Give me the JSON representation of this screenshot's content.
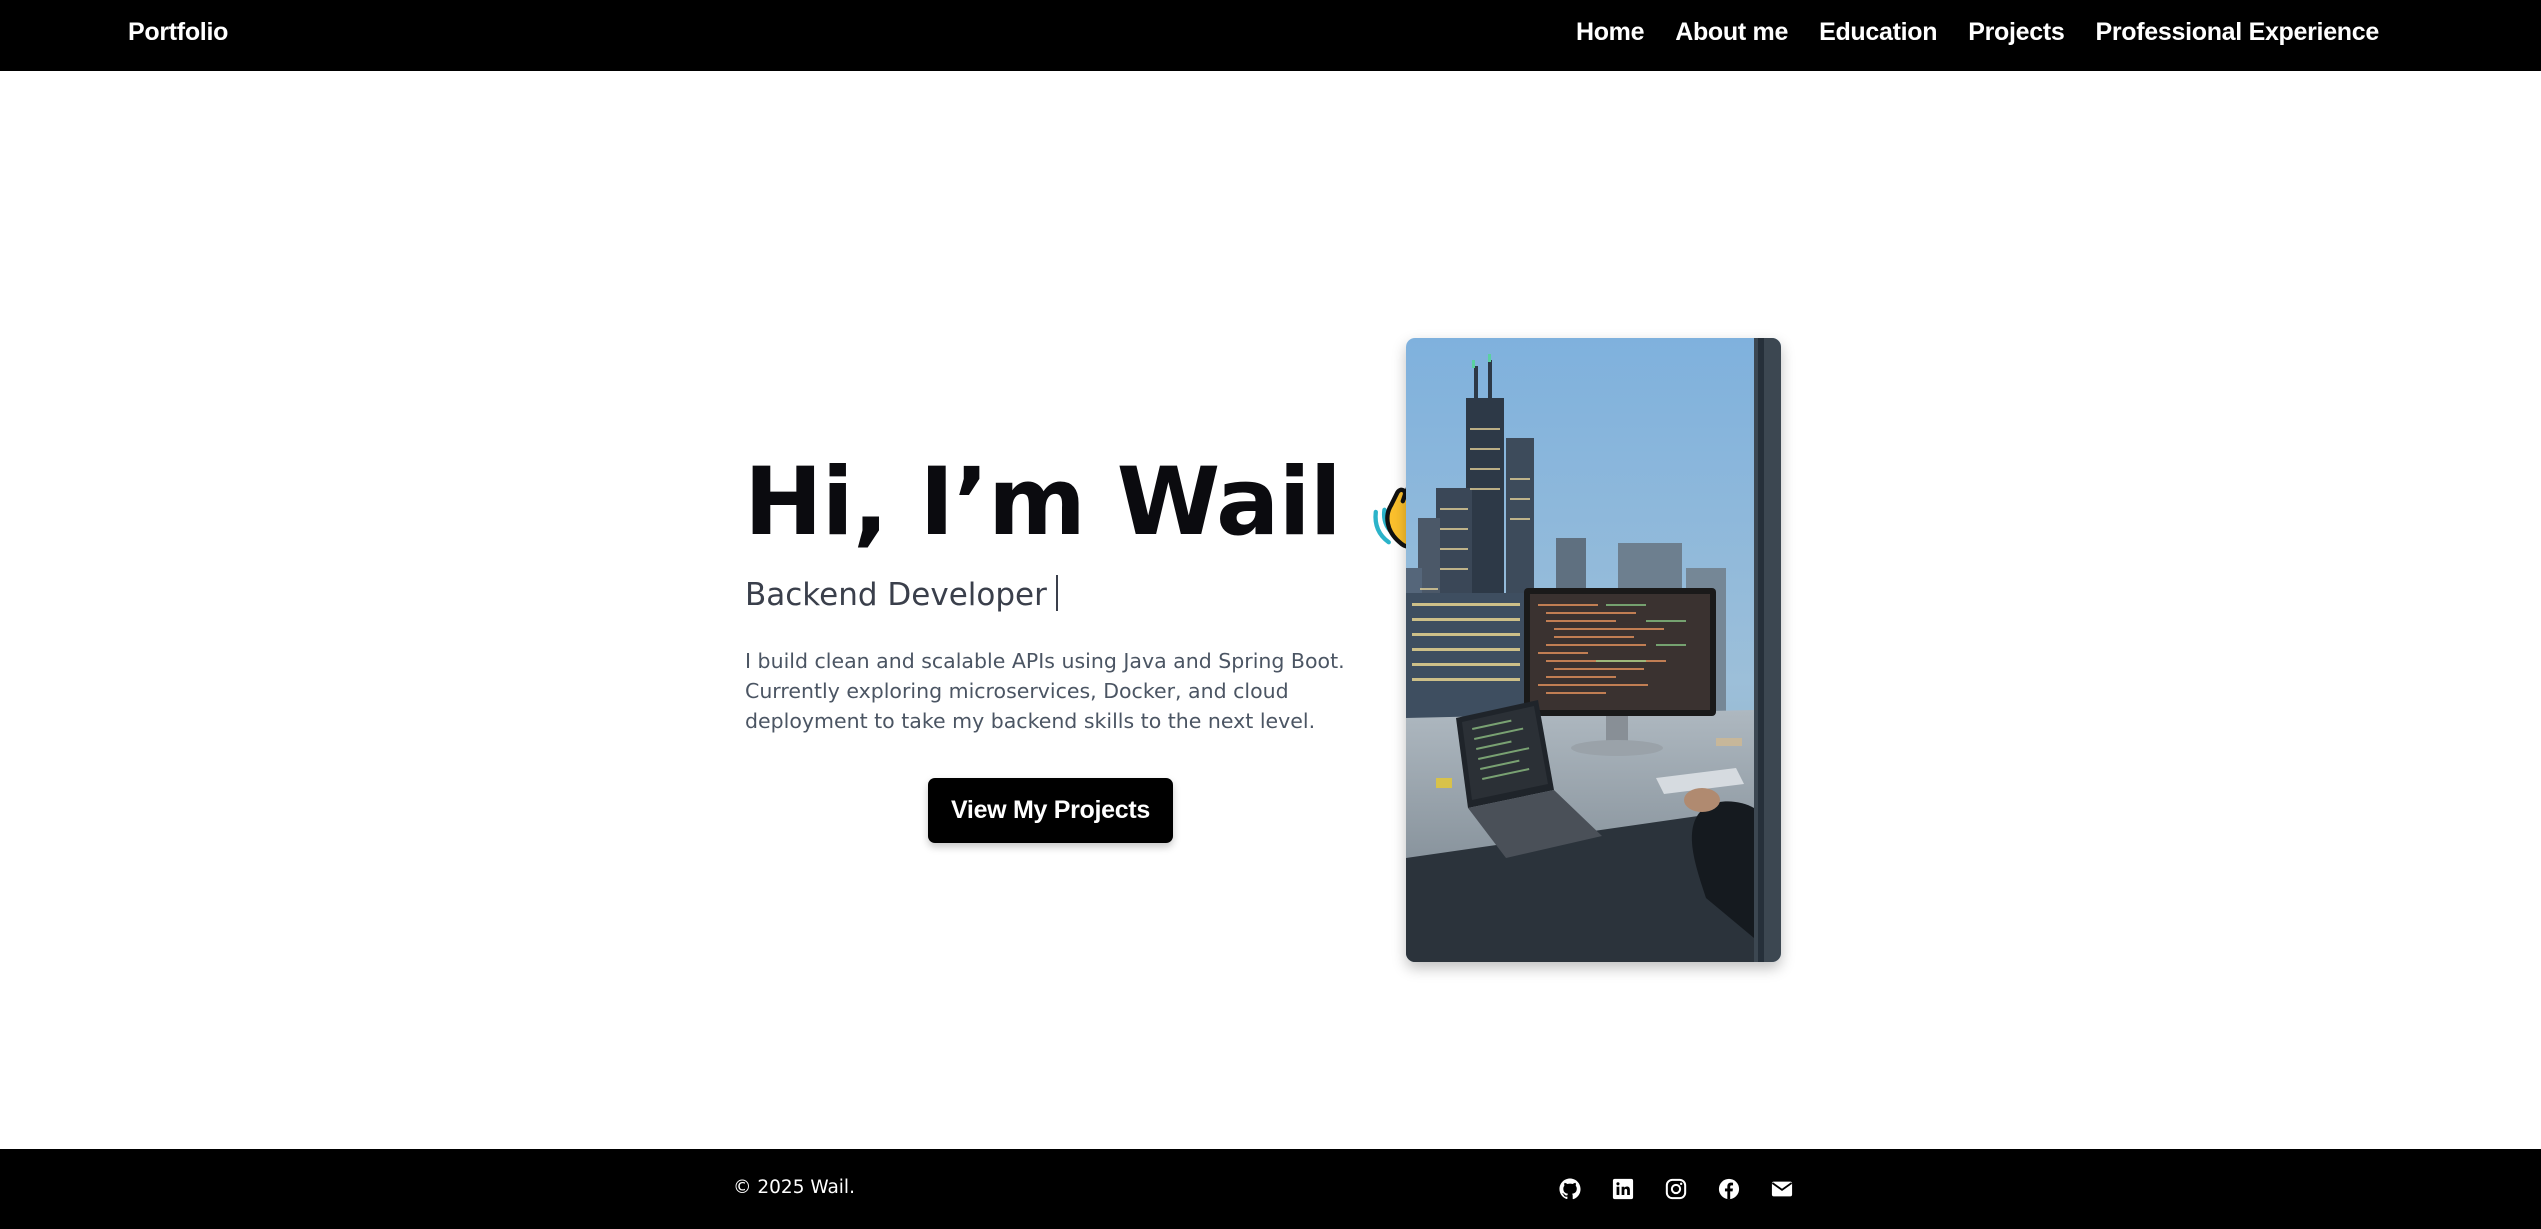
{
  "navbar": {
    "brand": "Portfolio",
    "links": [
      {
        "label": "Home"
      },
      {
        "label": "About me"
      },
      {
        "label": "Education"
      },
      {
        "label": "Projects"
      },
      {
        "label": "Professional Experience"
      }
    ]
  },
  "hero": {
    "heading": "Hi, I’m Wail",
    "heading_icon": "waving-hand-icon",
    "role": "Backend Developer",
    "description": "I build clean and scalable APIs using Java and Spring Boot. Currently exploring microservices, Docker, and cloud deployment to take my backend skills to the next level.",
    "cta_label": "View My Projects",
    "photo_icon": "desk-setup-photo"
  },
  "footer": {
    "copyright": "© 2025 Wail.",
    "social_icons": [
      "github-icon",
      "linkedin-icon",
      "instagram-icon",
      "facebook-icon",
      "email-icon"
    ]
  },
  "colors": {
    "nav_bg": "#000000",
    "text_dark": "#0b0b0f",
    "text_muted": "#4b5563",
    "button_bg": "#000000",
    "wave_yellow": "#fbc02d"
  }
}
